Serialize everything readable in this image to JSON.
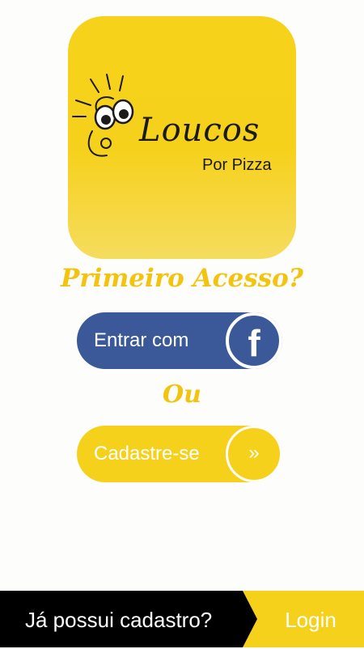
{
  "logo": {
    "main_text": "Loucos",
    "sub_text": "Por Pizza"
  },
  "headline": "Primeiro Acesso?",
  "facebook_button": {
    "label": "Entrar com",
    "icon": "facebook-icon",
    "color": "#3b5998"
  },
  "separator_text": "Ou",
  "register_button": {
    "label": "Cadastre-se",
    "icon": "double-chevron-right-icon",
    "icon_glyph": "»",
    "color": "#f6d11c"
  },
  "bottom_bar": {
    "question": "Já possui cadastro?",
    "login_label": "Login"
  },
  "colors": {
    "accent_yellow": "#f6d11c",
    "headline_yellow": "#f2c40f",
    "bar_black": "#000000"
  }
}
